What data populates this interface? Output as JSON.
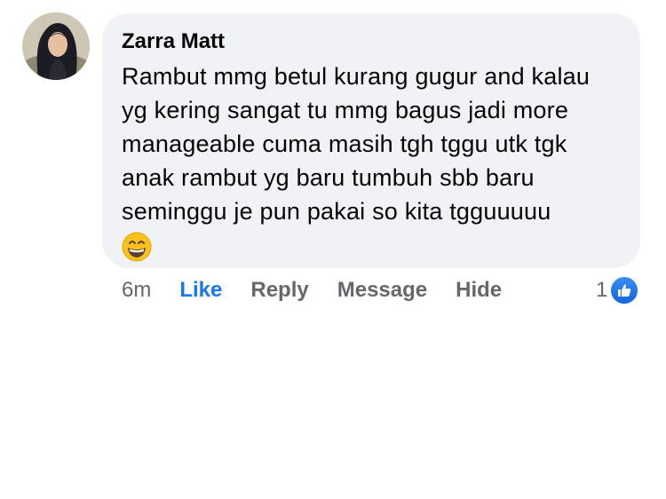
{
  "comment": {
    "author": "Zarra Matt",
    "text": "Rambut mmg betul kurang gugur and kalau\nyg kering sangat tu mmg bagus jadi more\nmanageable cuma masih tgh tggu utk tgk\nanak rambut yg baru tumbuh sbb baru\nseminggu je pun pakai so kita tgguuuuu",
    "emoji": "grinning-face-with-smiling-eyes-icon"
  },
  "actions": {
    "time": "6m",
    "like": "Like",
    "reply": "Reply",
    "message": "Message",
    "hide": "Hide"
  },
  "reactions": {
    "count": "1",
    "type": "like-icon"
  },
  "colors": {
    "bubble_bg": "#f0f2f5",
    "like_blue": "#1877f2",
    "muted_text": "#65676b"
  }
}
